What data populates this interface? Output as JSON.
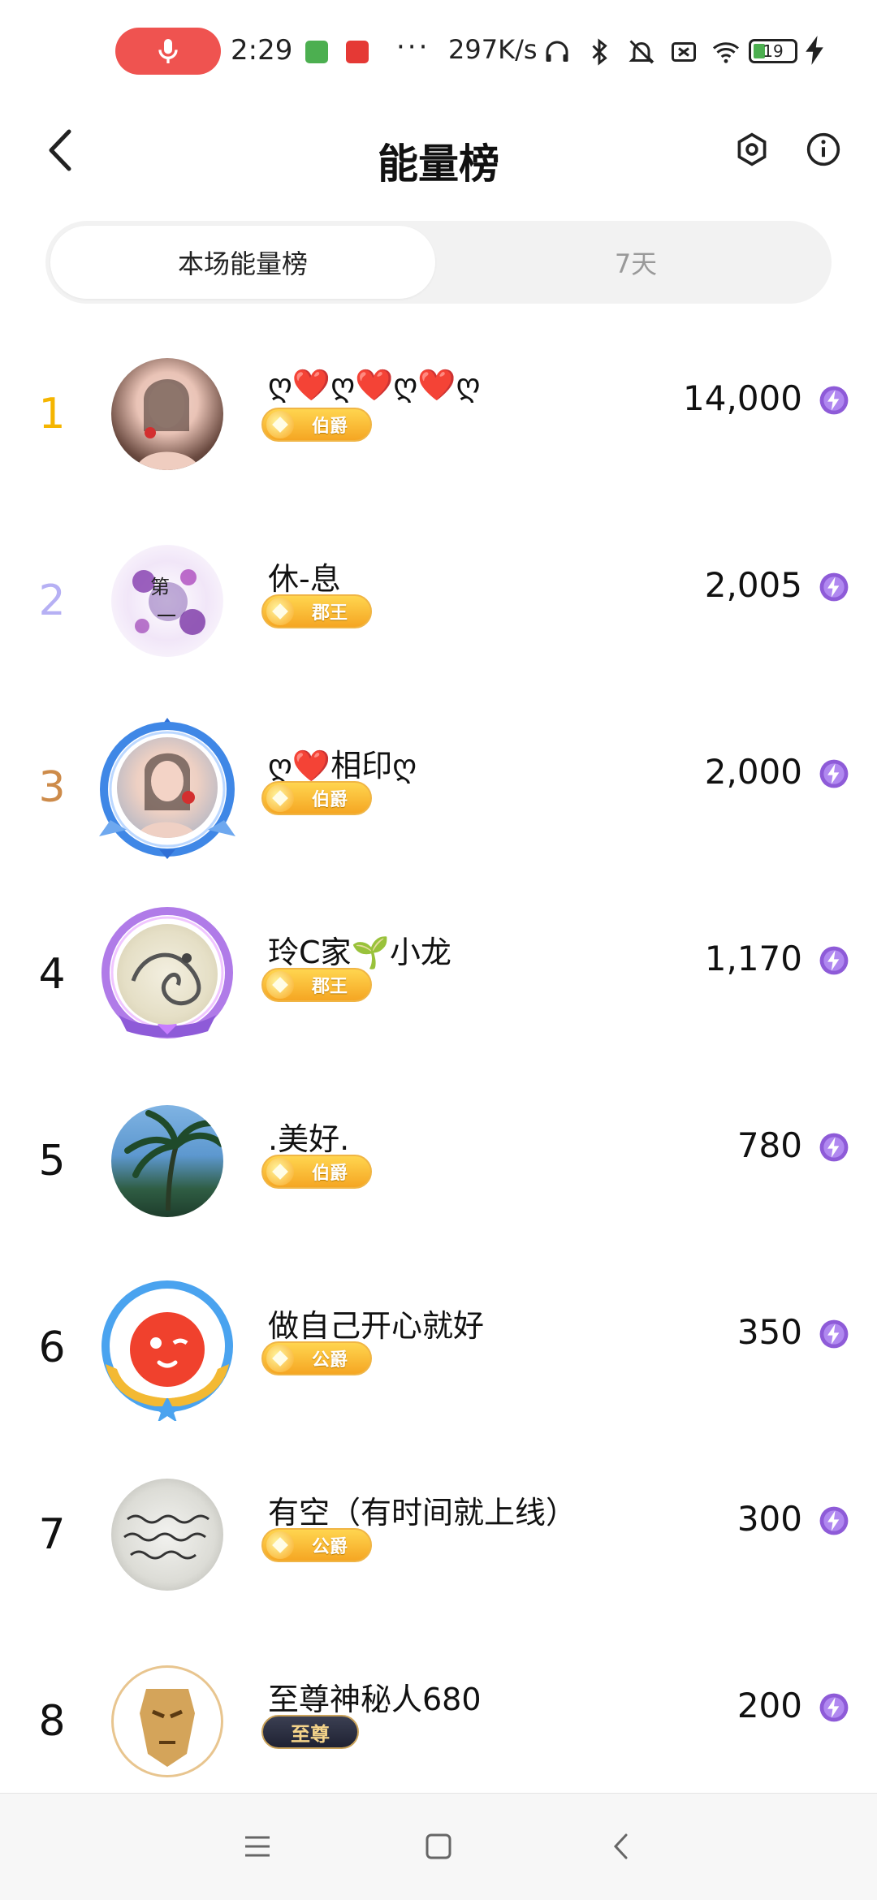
{
  "status_bar": {
    "time": "2:29",
    "dots": "···",
    "net_speed": "297K/s",
    "battery": "19"
  },
  "header": {
    "title": "能量榜"
  },
  "tabs": [
    {
      "label": "本场能量榜",
      "active": true
    },
    {
      "label": "7天",
      "active": false
    }
  ],
  "rank_colors": {
    "1": "#f5b500",
    "2": "#b6b0f4",
    "3": "#cd8b4a",
    "default": "#111111"
  },
  "leaderboard": [
    {
      "rank": "1",
      "name": "ღ❤️ღ❤️ღ❤️ღ",
      "badge": "伯爵",
      "score": "14,000"
    },
    {
      "rank": "2",
      "name": "休-息",
      "badge": "郡王",
      "score": "2,005"
    },
    {
      "rank": "3",
      "name": "ღ❤️相印ღ",
      "badge": "伯爵",
      "score": "2,000"
    },
    {
      "rank": "4",
      "name": "玲C家🌱小龙",
      "badge": "郡王",
      "score": "1,170"
    },
    {
      "rank": "5",
      "name": ".美好.",
      "badge": "伯爵",
      "score": "780"
    },
    {
      "rank": "6",
      "name": "做自己开心就好",
      "badge": "公爵",
      "score": "350"
    },
    {
      "rank": "7",
      "name": "有空（有时间就上线）",
      "badge": "公爵",
      "score": "300"
    },
    {
      "rank": "8",
      "name": "至尊神秘人680",
      "badge": "至尊",
      "score": "200"
    }
  ]
}
